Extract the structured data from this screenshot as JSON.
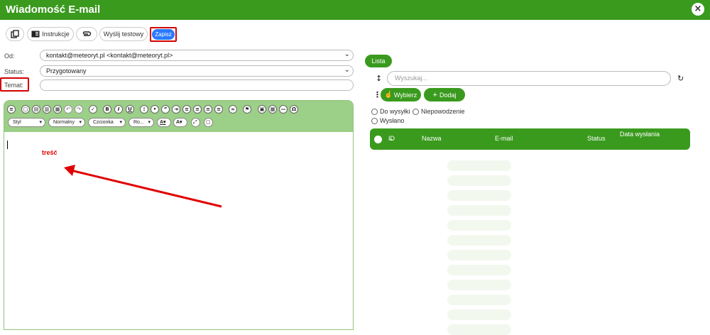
{
  "window": {
    "title": "Wiadomość E-mail",
    "close_label": "×"
  },
  "toolbar": {
    "instrukcje_label": "Instrukcje",
    "send_test_label": "Wyślij testowy",
    "save_label": "Zapisz"
  },
  "form": {
    "od_label": "Od:",
    "od_value": "kontakt@meteoryt.pl <kontakt@meteoryt.pl>",
    "status_label": "Status:",
    "status_value": "Przygotowany",
    "temat_label": "Temat:",
    "temat_value": ""
  },
  "editor": {
    "styl_label": "Styl",
    "format_label": "Normalny",
    "font_label": "Czcionka",
    "size_label": "Ro..."
  },
  "annotation": {
    "label": "treść",
    "color": "#e00000"
  },
  "right_panel": {
    "lista_label": "Lista",
    "search_placeholder": "Wyszukaj...",
    "wybierz_label": "Wybierz",
    "dodaj_label": "Dodaj",
    "filters": [
      "Do wysyłki",
      "Niepowodzenie",
      "Wysłano"
    ],
    "columns": [
      "ID",
      "Nazwa",
      "E-mail",
      "Status",
      "Data wysłania"
    ]
  },
  "colors": {
    "accent": "#3a9a1e",
    "editor_toolbar": "#9ccf87",
    "save_button": "#2979ff",
    "highlight": "#d40000"
  }
}
